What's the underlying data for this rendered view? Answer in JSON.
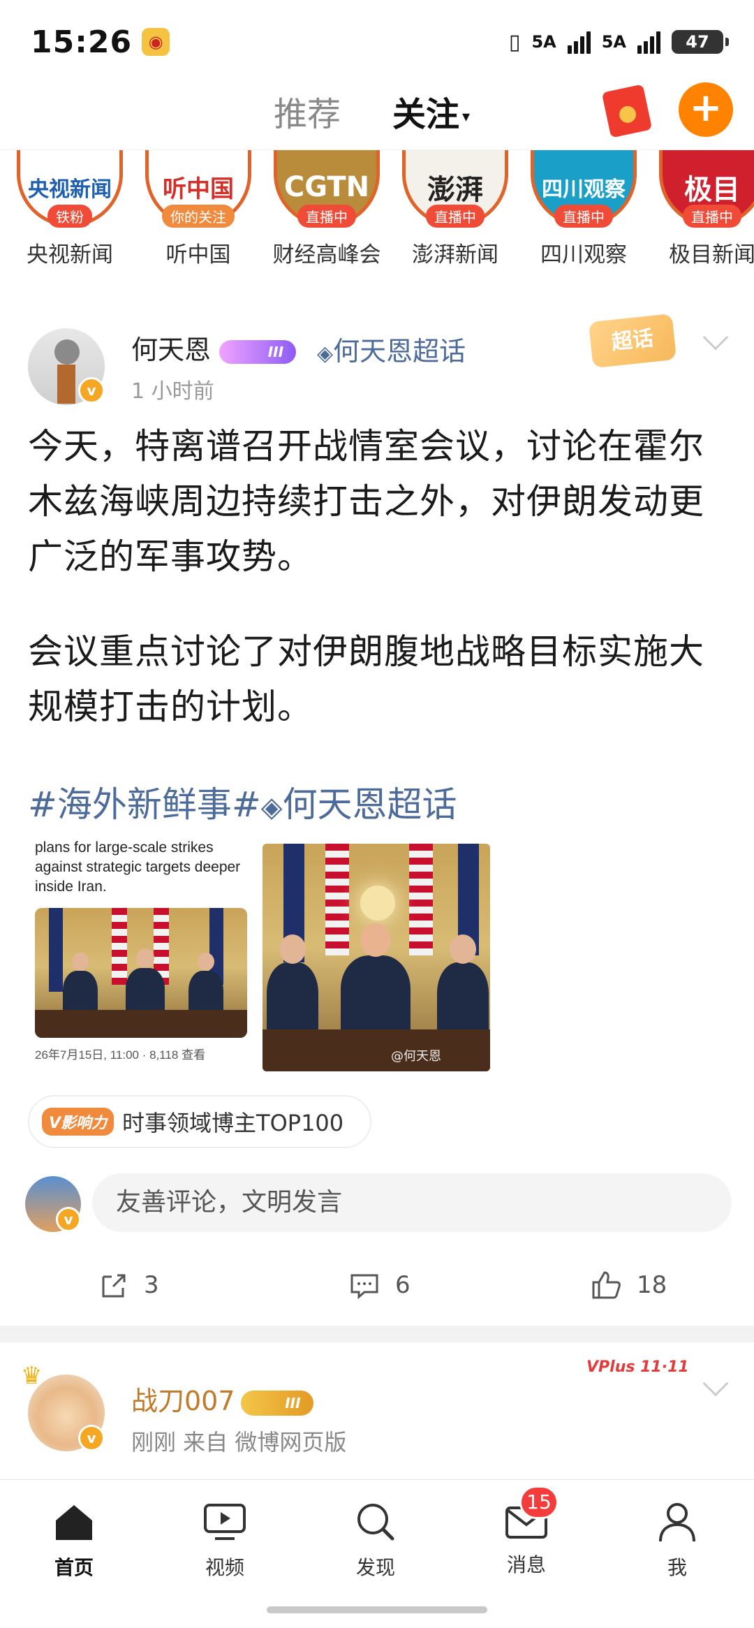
{
  "status_bar": {
    "time": "15:26",
    "signal_1": "5A",
    "signal_2": "5A",
    "battery": "47"
  },
  "top_nav": {
    "tab_recommend": "推荐",
    "tab_following": "关注"
  },
  "stories": [
    {
      "name": "央视新闻",
      "badge": "铁粉",
      "logo": "央视新闻",
      "color": "#1d5fb0"
    },
    {
      "name": "听中国",
      "badge": "你的关注",
      "logo": "听中国",
      "color": "#d4302a"
    },
    {
      "name": "财经高峰会",
      "badge": "直播中",
      "logo": "CGTN",
      "color": "#b98c3c"
    },
    {
      "name": "澎湃新闻",
      "badge": "直播中",
      "logo": "澎湃",
      "color": "#222222"
    },
    {
      "name": "四川观察",
      "badge": "直播中",
      "logo": "四川观察",
      "color": "#1aa0c8"
    },
    {
      "name": "极目新闻",
      "badge": "直播中",
      "logo": "极目",
      "color": "#d0202e"
    }
  ],
  "post1": {
    "author": "何天恩",
    "level": "III",
    "topic": "何天恩超话",
    "time": "1 小时前",
    "chat_tag": "超话",
    "paragraph1": "今天，特离谱召开战情室会议，讨论在霍尔木兹海峡周边持续打击之外，对伊朗发动更广泛的军事攻势。",
    "paragraph2": "会议重点讨论了对伊朗腹地战略目标实施大规模打击的计划。",
    "hashtag": "#海外新鲜事#",
    "hashtag_topic": "何天恩超话",
    "image1_caption": "plans for large-scale strikes against strategic targets deeper inside Iran.",
    "image1_footer": "26年7月15日, 11:00 · 8,118 查看",
    "image2_watermark": "@何天恩",
    "influence_tag": "V影响力",
    "influence_text": "时事领域博主TOP100",
    "comment_placeholder": "友善评论，文明发言",
    "shares": "3",
    "comments": "6",
    "likes": "18"
  },
  "post2": {
    "author": "战刀007",
    "level": "III",
    "meta": "刚刚  来自 微博网页版",
    "vplus": "VPlus 11·11"
  },
  "bottom_nav": {
    "home": "首页",
    "video": "视频",
    "discover": "发现",
    "messages": "消息",
    "messages_badge": "15",
    "me": "我"
  }
}
